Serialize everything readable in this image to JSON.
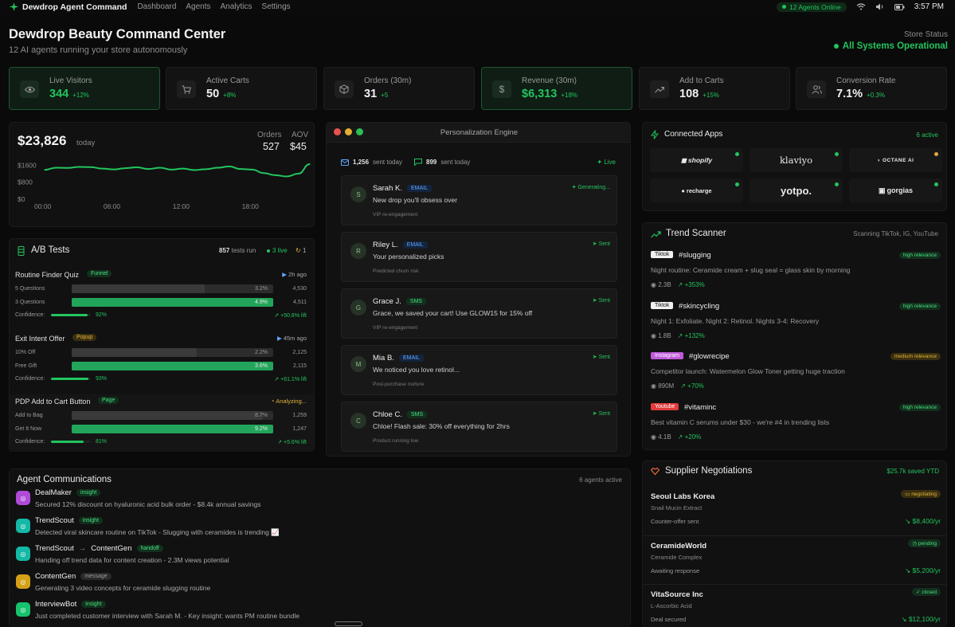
{
  "topbar": {
    "brand": "Dewdrop Agent Command",
    "nav": [
      "Dashboard",
      "Agents",
      "Analytics",
      "Settings"
    ],
    "agents_online": "12 Agents Online",
    "clock": "3:57 PM"
  },
  "header": {
    "title": "Dewdrop Beauty Command Center",
    "subtitle": "12 AI agents running your store autonomously",
    "store_status_label": "Store Status",
    "store_status_value": "All Systems Operational"
  },
  "stats": [
    {
      "label": "Live Visitors",
      "value": "344",
      "change": "+12%",
      "icon": "eye-icon"
    },
    {
      "label": "Active Carts",
      "value": "50",
      "change": "+8%",
      "icon": "cart-icon"
    },
    {
      "label": "Orders (30m)",
      "value": "31",
      "change": "+5",
      "icon": "box-icon"
    },
    {
      "label": "Revenue (30m)",
      "value": "$6,313",
      "change": "+18%",
      "icon": "dollar-icon"
    },
    {
      "label": "Add to Carts",
      "value": "108",
      "change": "+15%",
      "icon": "trend-up-icon"
    },
    {
      "label": "Conversion Rate",
      "value": "7.1%",
      "change": "+0.3%",
      "icon": "users-icon"
    }
  ],
  "revenue": {
    "amount": "$23,826",
    "period": "today",
    "orders_label": "Orders",
    "orders_value": "527",
    "aov_label": "AOV",
    "aov_value": "$45"
  },
  "chart_data": {
    "type": "line",
    "x": [
      "00:00",
      "01:00",
      "02:00",
      "03:00",
      "04:00",
      "05:00",
      "06:00",
      "07:00",
      "08:00",
      "09:00",
      "10:00",
      "11:00",
      "12:00",
      "13:00",
      "14:00",
      "15:00",
      "16:00",
      "17:00",
      "18:00",
      "19:00",
      "20:00",
      "21:00",
      "22:00",
      "23:00"
    ],
    "values": [
      1380,
      1480,
      1470,
      1520,
      1510,
      1440,
      1400,
      1460,
      1500,
      1420,
      1480,
      1390,
      1440,
      1370,
      1410,
      1480,
      1540,
      1420,
      1390,
      1230,
      1130,
      1070,
      1200,
      1650
    ],
    "xticks": [
      "00:00",
      "06:00",
      "12:00",
      "18:00"
    ],
    "yticks": [
      "$1600",
      "$800",
      "$0"
    ],
    "ylim": [
      0,
      1800
    ],
    "color": "#22c55e"
  },
  "ab_tests": {
    "title": "A/B Tests",
    "tests_run_value": "857",
    "tests_run_label": "tests run",
    "live": "3 live",
    "pending": "1",
    "tests": [
      {
        "name": "Routine Finder Quiz",
        "type": "Funnel",
        "status": "2h ago",
        "variants": [
          {
            "label": "5 Questions",
            "rate": "3.2%",
            "count": "4,530",
            "fill": 0.66,
            "win": false
          },
          {
            "label": "3 Questions",
            "rate": "4.9%",
            "count": "4,511",
            "fill": 1.0,
            "win": true
          }
        ],
        "confidence_label": "Confidence:",
        "confidence": "92%",
        "confidence_fill": 0.92,
        "lift": "+50.8% lift"
      },
      {
        "name": "Exit Intent Offer",
        "type": "Popup",
        "status": "45m ago",
        "variants": [
          {
            "label": "10% Off",
            "rate": "2.2%",
            "count": "2,125",
            "fill": 0.62,
            "win": false
          },
          {
            "label": "Free Gift",
            "rate": "3.6%",
            "count": "2,115",
            "fill": 1.0,
            "win": true
          }
        ],
        "confidence_label": "Confidence:",
        "confidence": "93%",
        "confidence_fill": 0.93,
        "lift": "+61.1% lift"
      },
      {
        "name": "PDP Add to Cart Button",
        "type": "Page",
        "status": "Analyzing...",
        "variants": [
          {
            "label": "Add to Bag",
            "rate": "8.7%",
            "count": "1,259",
            "fill": 0.95,
            "win": false
          },
          {
            "label": "Get It Now",
            "rate": "9.2%",
            "count": "1,247",
            "fill": 1.0,
            "win": true
          }
        ],
        "confidence_label": "Confidence:",
        "confidence": "81%",
        "confidence_fill": 0.81,
        "lift": "+5.6% lift"
      }
    ]
  },
  "personalization": {
    "title": "Personalization Engine",
    "emails_sent": "1,256",
    "emails_label": "sent today",
    "sms_sent": "899",
    "sms_label": "sent today",
    "live": "Live",
    "messages": [
      {
        "initial": "S",
        "name": "Sarah K.",
        "channel": "EMAIL",
        "text": "New drop you'll obsess over",
        "segment": "VIP re-engagement",
        "status": "Generating..."
      },
      {
        "initial": "R",
        "name": "Riley L.",
        "channel": "EMAIL",
        "text": "Your personalized picks",
        "segment": "Predicted churn risk",
        "status": "Sent"
      },
      {
        "initial": "G",
        "name": "Grace J.",
        "channel": "SMS",
        "text": "Grace, we saved your cart! Use GLOW15 for 15% off",
        "segment": "VIP re-engagement",
        "status": "Sent"
      },
      {
        "initial": "M",
        "name": "Mia B.",
        "channel": "EMAIL",
        "text": "We noticed you love retinol...",
        "segment": "Post-purchase nurture",
        "status": "Sent"
      },
      {
        "initial": "C",
        "name": "Chloe C.",
        "channel": "SMS",
        "text": "Chloe! Flash sale: 30% off everything for 2hrs",
        "segment": "Product running low",
        "status": "Sent"
      }
    ]
  },
  "connected_apps": {
    "title": "Connected Apps",
    "count": "6 active",
    "apps": [
      {
        "name": "shopify",
        "status_color": "#22c55e"
      },
      {
        "name": "klaviyo",
        "status_color": "#22c55e"
      },
      {
        "name": "OCTANE AI",
        "status_color": "#e2a93c"
      },
      {
        "name": "recharge",
        "status_color": "#22c55e"
      },
      {
        "name": "yotpo.",
        "status_color": "#22c55e"
      },
      {
        "name": "gorgias",
        "status_color": "#22c55e"
      }
    ]
  },
  "trends": {
    "title": "Trend Scanner",
    "scanning": "Scanning TikTok, IG, YouTube",
    "items": [
      {
        "platform": "Tiktok",
        "tag": "#slugging",
        "relevance": "high relevance",
        "desc": "Night routine: Ceramide cream + slug seal = glass skin by morning",
        "views": "2.3B",
        "growth": "+353%"
      },
      {
        "platform": "Tiktok",
        "tag": "#skincycling",
        "relevance": "high relevance",
        "desc": "Night 1: Exfoliate. Night 2: Retinol. Nights 3-4: Recovery",
        "views": "1.8B",
        "growth": "+132%"
      },
      {
        "platform": "Instagram",
        "tag": "#glowrecipe",
        "relevance": "medium relevance",
        "desc": "Competitor launch: Watermelon Glow Toner getting huge traction",
        "views": "890M",
        "growth": "+70%"
      },
      {
        "platform": "Youtube",
        "tag": "#vitaminc",
        "relevance": "high relevance",
        "desc": "Best vitamin C serums under $30 - we're #4 in trending lists",
        "views": "4.1B",
        "growth": "+20%"
      }
    ]
  },
  "communications": {
    "title": "Agent Communications",
    "active": "6 agents active",
    "items": [
      {
        "agent": "DealMaker",
        "target": "",
        "kind": "insight",
        "text": "Secured 12% discount on hyaluronic acid bulk order - $8.4k annual savings",
        "color": "#b04ad8"
      },
      {
        "agent": "TrendScout",
        "target": "",
        "kind": "insight",
        "text": "Detected viral skincare routine on TikTok - Slugging with ceramides is trending 📈",
        "color": "#14b8a6"
      },
      {
        "agent": "TrendScout",
        "target": "ContentGen",
        "kind": "handoff",
        "text": "Handing off trend data for content creation - 2.3M views potential",
        "color": "#14b8a6"
      },
      {
        "agent": "ContentGen",
        "target": "",
        "kind": "message",
        "text": "Generating 3 video concepts for ceramide slugging routine",
        "color": "#d4a017"
      },
      {
        "agent": "InterviewBot",
        "target": "",
        "kind": "insight",
        "text": "Just completed customer interview with Sarah M. - Key insight: wants PM routine bundle",
        "color": "#16c26b"
      }
    ]
  },
  "suppliers": {
    "title": "Supplier Negotiations",
    "saved": "$25.7k saved YTD",
    "items": [
      {
        "name": "Seoul Labs Korea",
        "product": "Snail Mucin Extract",
        "status": "Counter-offer sent",
        "badge": "negotiating",
        "value": "$8,400/yr"
      },
      {
        "name": "CeramideWorld",
        "product": "Ceramide Complex",
        "status": "Awaiting response",
        "badge": "pending",
        "value": "$5,200/yr"
      },
      {
        "name": "VitaSource Inc",
        "product": "L-Ascorbic Acid",
        "status": "Deal secured",
        "badge": "closed",
        "value": "$12,100/yr"
      }
    ]
  }
}
